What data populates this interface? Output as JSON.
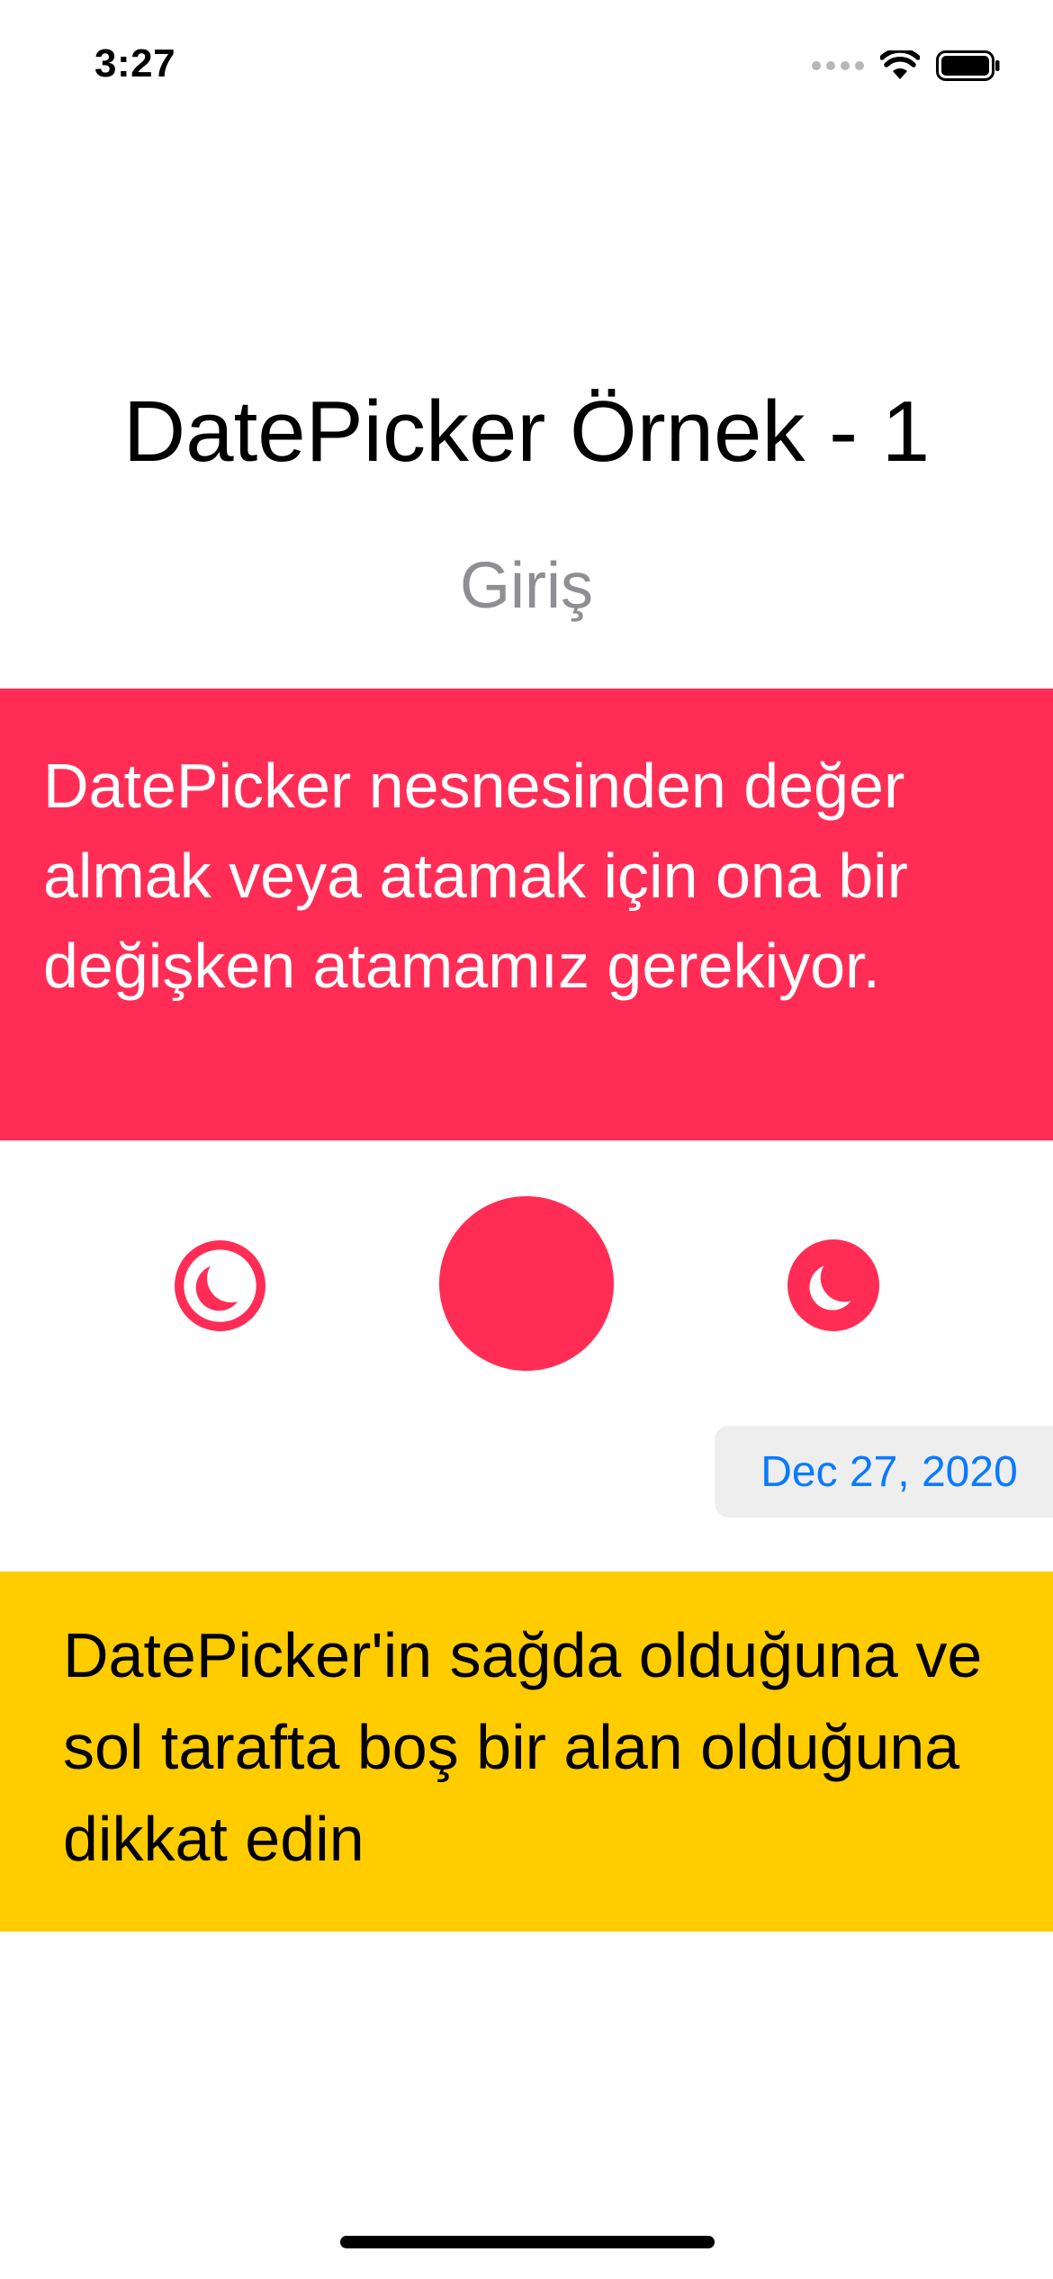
{
  "status_bar": {
    "time": "3:27"
  },
  "header": {
    "title": "DatePicker Örnek - 1",
    "subtitle": "Giriş"
  },
  "info_box": {
    "text": "DatePicker nesnesinden değer almak veya atamak için ona bir değişken atamamız gerekiyor.",
    "color": "#ff2d55"
  },
  "icons": {
    "left": "moon-circle-outline-icon",
    "center": "filled-circle-icon",
    "right": "moon-circle-filled-icon",
    "color": "#ff2d55"
  },
  "date_picker": {
    "value": "Dec 27, 2020",
    "text_color": "#0a7aff"
  },
  "note_box": {
    "text": "DatePicker'in sağda olduğuna ve sol tarafta boş bir alan olduğuna dikkat edin",
    "color": "#ffcc00"
  }
}
